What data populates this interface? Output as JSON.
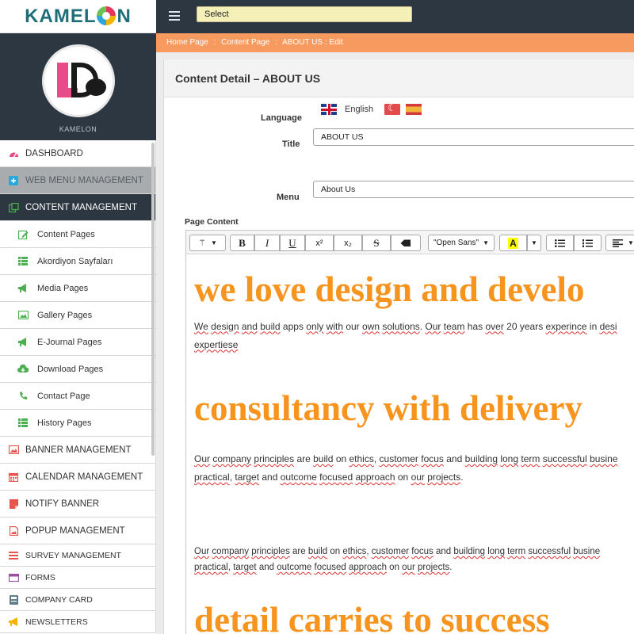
{
  "logo": {
    "text_left": "KAMEL",
    "text_right": "N"
  },
  "profile": {
    "name": "KAMELON"
  },
  "topbar": {
    "select_label": "Select"
  },
  "breadcrumb": [
    "Home Page",
    ":",
    "Content Page",
    ":",
    "ABOUT US : Edit"
  ],
  "panel": {
    "title": "Content Detail – ABOUT US"
  },
  "form": {
    "language_label": "Language",
    "language_value": "English",
    "title_label": "Title",
    "title_value": "ABOUT US",
    "menu_label": "Menu",
    "menu_value": "About Us",
    "page_content_label": "Page Content"
  },
  "toolbar": {
    "bold": "B",
    "italic": "I",
    "underline": "U",
    "superscript": "x²",
    "subscript": "x₂",
    "strike": "S",
    "font": "\"Open Sans\"",
    "color": "A"
  },
  "sidebar": [
    {
      "label": "DASHBOARD",
      "icon": "dashboard-icon",
      "color": "#e84c88"
    },
    {
      "label": "WEB MENU MANAGEMENT",
      "icon": "plus-square-icon",
      "color": "#2aa8d8"
    },
    {
      "label": "CONTENT MANAGEMENT",
      "icon": "copy-icon",
      "color": "#4caf50"
    },
    {
      "label": "Content Pages",
      "icon": "edit-icon",
      "color": "#4caf50"
    },
    {
      "label": "Akordiyon Sayfaları",
      "icon": "list-icon",
      "color": "#4caf50"
    },
    {
      "label": "Media Pages",
      "icon": "bullhorn-icon",
      "color": "#4caf50"
    },
    {
      "label": "Gallery Pages",
      "icon": "image-icon",
      "color": "#4caf50"
    },
    {
      "label": "E-Journal Pages",
      "icon": "bullhorn-icon",
      "color": "#4caf50"
    },
    {
      "label": "Download Pages",
      "icon": "cloud-download-icon",
      "color": "#4caf50"
    },
    {
      "label": "Contact Page",
      "icon": "phone-icon",
      "color": "#4caf50"
    },
    {
      "label": "History Pages",
      "icon": "list-icon",
      "color": "#4caf50"
    },
    {
      "label": "BANNER MANAGEMENT",
      "icon": "image-icon",
      "color": "#e8554e"
    },
    {
      "label": "CALENDAR MANAGEMENT",
      "icon": "calendar-icon",
      "color": "#e8554e"
    },
    {
      "label": "NOTIFY BANNER",
      "icon": "note-icon",
      "color": "#e8554e"
    },
    {
      "label": "POPUP MANAGEMENT",
      "icon": "file-image-icon",
      "color": "#e8554e"
    },
    {
      "label": "SURVEY MANAGEMENT",
      "icon": "bars-icon",
      "color": "#e8554e"
    },
    {
      "label": "FORMS",
      "icon": "form-icon",
      "color": "#9c4f9e"
    },
    {
      "label": "COMPANY CARD",
      "icon": "card-icon",
      "color": "#607d8b"
    },
    {
      "label": "NEWSLETTERS",
      "icon": "megaphone-icon",
      "color": "#f5b400"
    }
  ],
  "content": {
    "heading1": "we love design and develo",
    "para1_line1": [
      "We",
      " ",
      "design",
      " ",
      "and",
      " ",
      "build",
      " apps ",
      "only",
      " ",
      "with",
      " our ",
      "own",
      " ",
      "solutions",
      ". ",
      "Our",
      " ",
      "team",
      " has ",
      "over",
      " 20 years ",
      "experince",
      " in ",
      "desi"
    ],
    "para1_line2": "expertiese",
    "heading2": "consultancy with delivery",
    "para2_line1": [
      "Our",
      " ",
      "company",
      " ",
      "principles",
      " are ",
      "build",
      " on ",
      "ethics",
      ", ",
      "customer",
      " ",
      "focus",
      " and ",
      "building",
      " ",
      "long",
      " ",
      "term",
      " ",
      "successful",
      " ",
      "busine"
    ],
    "para2_line2": [
      "practical",
      ", ",
      "target",
      " and ",
      "outcome",
      " ",
      "focused",
      " ",
      "approach",
      " on ",
      "our",
      " ",
      "projects",
      "."
    ],
    "heading4": "detail carries to success"
  },
  "colors": {
    "accent": "#f7941d",
    "breadcrumb": "#f79a5f",
    "dark": "#2d3741"
  }
}
